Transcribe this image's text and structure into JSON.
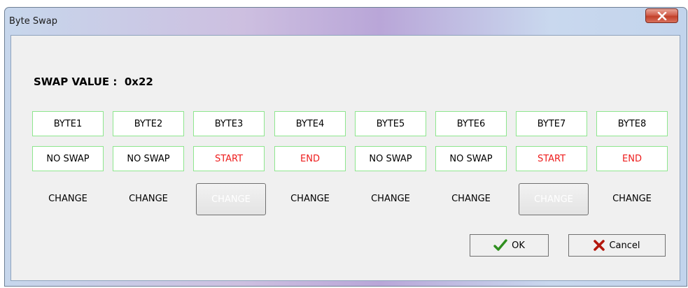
{
  "window": {
    "title": "Byte Swap"
  },
  "swap": {
    "label": "SWAP VALUE :",
    "value": "0x22"
  },
  "bytes": [
    {
      "name": "BYTE1",
      "status": "NO SWAP",
      "change": "CHANGE"
    },
    {
      "name": "BYTE2",
      "status": "NO SWAP",
      "change": "CHANGE"
    },
    {
      "name": "BYTE3",
      "status": "START",
      "change": "CHANGE"
    },
    {
      "name": "BYTE4",
      "status": "END",
      "change": "CHANGE"
    },
    {
      "name": "BYTE5",
      "status": "NO SWAP",
      "change": "CHANGE"
    },
    {
      "name": "BYTE6",
      "status": "NO SWAP",
      "change": "CHANGE"
    },
    {
      "name": "BYTE7",
      "status": "START",
      "change": "CHANGE"
    },
    {
      "name": "BYTE8",
      "status": "END",
      "change": "CHANGE"
    }
  ],
  "buttons": {
    "ok": "OK",
    "cancel": "Cancel"
  },
  "icons": {
    "close": "close-icon",
    "ok": "checkmark-icon",
    "cancel": "x-mark-icon"
  },
  "colors": {
    "cell_border": "#8ee68e",
    "status_active": "#ee1c1c",
    "ok_check": "#2f8f1f",
    "cancel_x": "#b3170d"
  }
}
